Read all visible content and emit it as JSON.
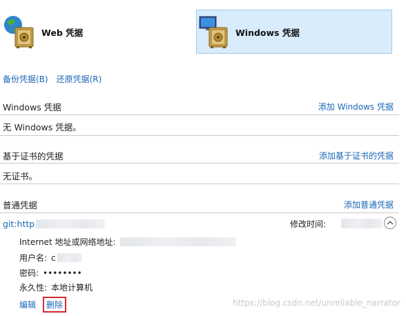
{
  "tiles": {
    "web": {
      "label": "Web 凭据",
      "icon": "web-credential-safe-icon"
    },
    "windows": {
      "label": "Windows 凭据",
      "icon": "windows-credential-safe-icon",
      "selected": true
    }
  },
  "top_links": {
    "backup": "备份凭据(B)",
    "restore": "还原凭据(R)"
  },
  "windows_section": {
    "title": "Windows 凭据",
    "add_link": "添加 Windows 凭据",
    "empty_text": "无 Windows 凭据。"
  },
  "cert_section": {
    "title": "基于证书的凭据",
    "add_link": "添加基于证书的凭据",
    "empty_text": "无证书。"
  },
  "generic_section": {
    "title": "普通凭据",
    "add_link": "添加普通凭据",
    "entry": {
      "name_prefix": "git:http",
      "modified_label": "修改时间:",
      "collapse_icon": "chevron-up-icon",
      "details": {
        "address_label": "Internet 地址或网络地址:",
        "username_label": "用户名:",
        "username_prefix": "c",
        "password_label": "密码:",
        "password_value": "••••••••",
        "persistence_label": "永久性:",
        "persistence_value": "本地计算机"
      },
      "edit_label": "编辑",
      "delete_label": "删除"
    }
  },
  "watermark": "https://blog.csdn.net/unreliable_narrator",
  "colors": {
    "link": "#1a66b7",
    "selected_tile_bg": "#d9ecfb",
    "highlight_border": "#d42b2b"
  }
}
